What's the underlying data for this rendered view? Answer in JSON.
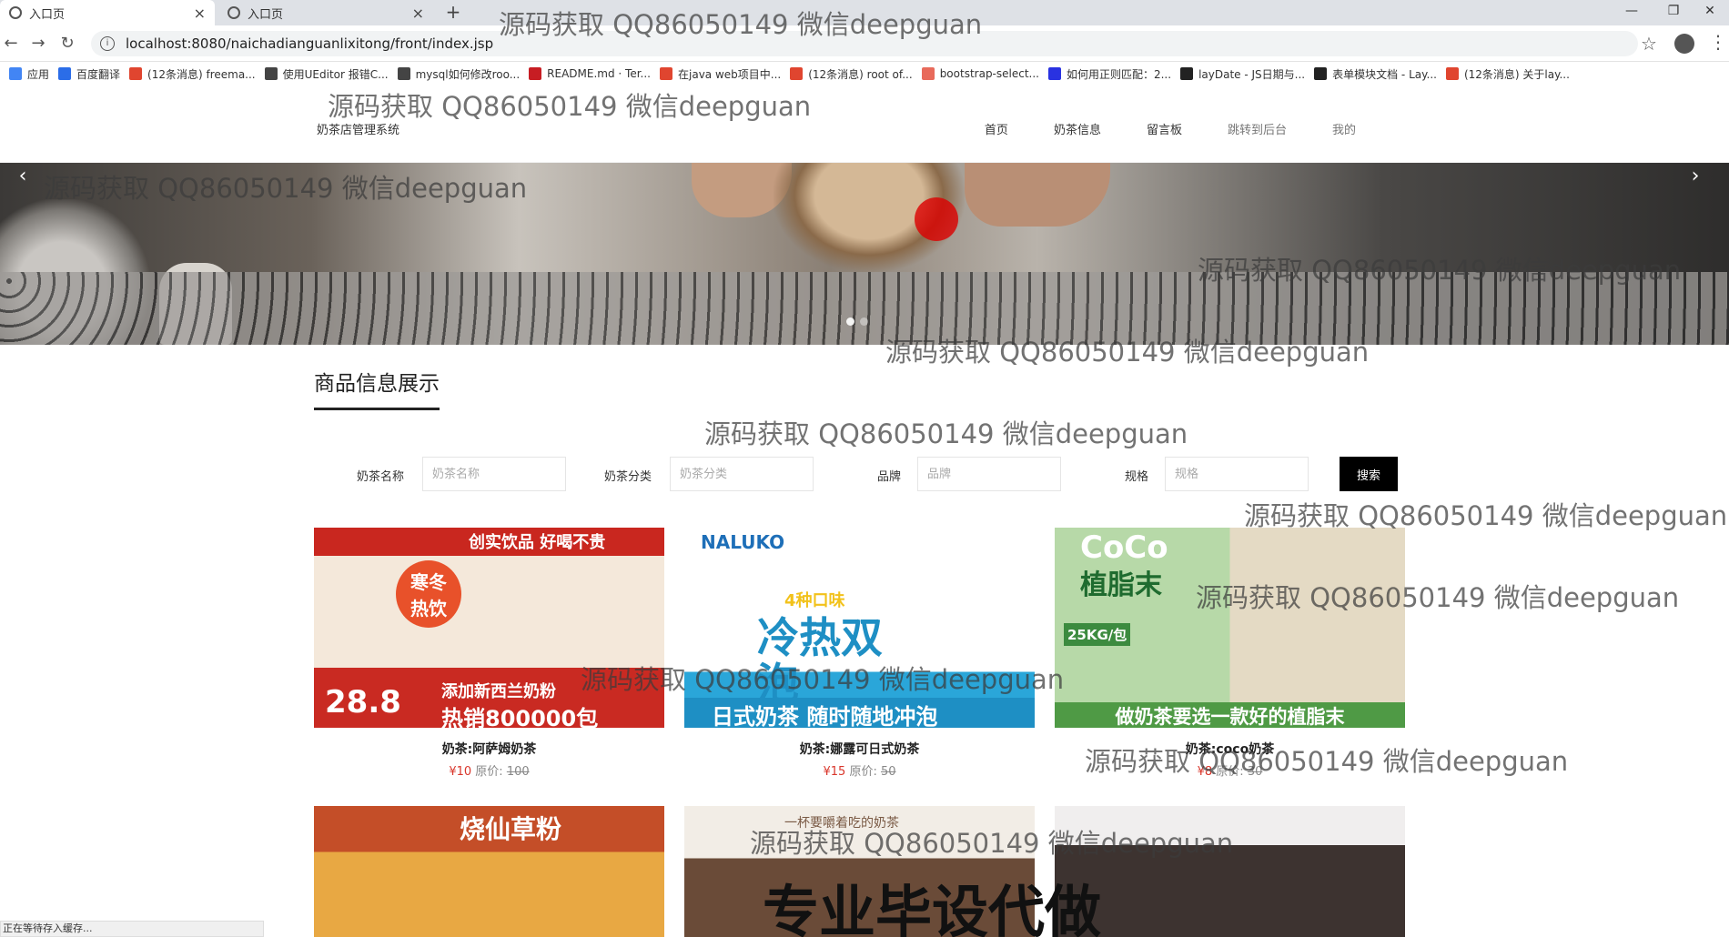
{
  "browser": {
    "tabs": [
      {
        "label": "入口页",
        "close": "×"
      },
      {
        "label": "入口页",
        "close": "×"
      }
    ],
    "new_tab": "+",
    "window_controls": [
      "—",
      "❐",
      "✕"
    ],
    "url": "localhost:8080/naichadianguanlixitong/front/index.jsp",
    "bookmarks": [
      "应用",
      "百度翻译",
      "(12条消息) freema...",
      "使用UEditor 报错C...",
      "mysql如何修改roo...",
      "README.md · Ter...",
      "在java web项目中...",
      "(12条消息) root of...",
      "bootstrap-select...",
      "如何用正则匹配：2...",
      "layDate - JS日期与...",
      "表单模块文档 - Lay...",
      "(12条消息) 关于lay..."
    ]
  },
  "site": {
    "title": "奶茶店管理系统",
    "nav": [
      "首页",
      "奶茶信息",
      "留言板",
      "跳转到后台",
      "我的"
    ]
  },
  "section": {
    "title": "商品信息展示"
  },
  "search": {
    "fields": [
      {
        "label": "奶茶名称",
        "placeholder": "奶茶名称"
      },
      {
        "label": "奶茶分类",
        "placeholder": "奶茶分类"
      },
      {
        "label": "品牌",
        "placeholder": "品牌"
      },
      {
        "label": "规格",
        "placeholder": "规格"
      }
    ],
    "button": "搜索"
  },
  "products": [
    {
      "name": "奶茶:阿萨姆奶茶",
      "price": "¥10",
      "orig_label": "原价:",
      "orig": "100",
      "img_text": [
        "创实饮品 好喝不贵",
        "寒冬热饮",
        "28.8",
        "添加新西兰奶粉",
        "热销800000包"
      ]
    },
    {
      "name": "奶茶:娜露可日式奶茶",
      "price": "¥15",
      "orig_label": "原价:",
      "orig": "50",
      "img_text": [
        "NALUKO",
        "4种口味",
        "冷热双泡",
        "日式奶茶 随时随地冲泡"
      ]
    },
    {
      "name": "奶茶:coco奶茶",
      "price": "¥8",
      "orig_label": "原价:",
      "orig": "30",
      "img_text": [
        "CoCo",
        "植脂末",
        "25KG/包",
        "做奶茶要选一款好的植脂末"
      ]
    },
    {
      "img_text": [
        "烧仙草粉"
      ]
    },
    {
      "img_text": [
        "一杯要嚼着吃的奶茶"
      ]
    },
    {
      "img_text": []
    }
  ],
  "status_bar": "正在等待存入缓存...",
  "watermark": "源码获取 QQ86050149 微信deepguan",
  "overlay_text": "专业毕设代做",
  "colors": {
    "accent": "#000000",
    "price": "#d9362b",
    "cursor_ring": "#dc0000"
  }
}
